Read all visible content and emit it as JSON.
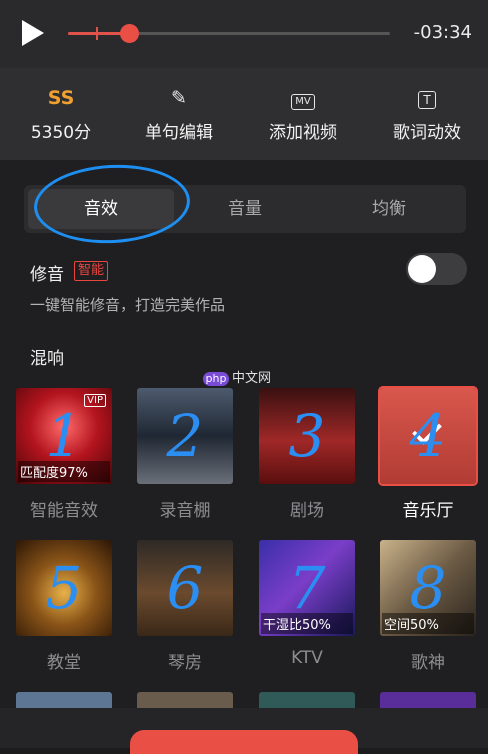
{
  "player": {
    "time_remaining": "-03:34",
    "progress": 0.19
  },
  "toolbar": [
    {
      "icon": "score-icon",
      "glyph": "SS",
      "label": "5350分"
    },
    {
      "icon": "edit-line-icon",
      "glyph": "✎",
      "label": "单句编辑"
    },
    {
      "icon": "mv-icon",
      "glyph": "MV",
      "label": "添加视频"
    },
    {
      "icon": "lyric-effect-icon",
      "glyph": "T",
      "label": "歌词动效"
    }
  ],
  "tabs": [
    "音效",
    "音量",
    "均衡"
  ],
  "tune": {
    "title": "修音",
    "badge": "智能",
    "desc": "一键智能修音，打造完美作品",
    "enabled": false
  },
  "reverb": {
    "title": "混响",
    "items": [
      {
        "name": "智能音效",
        "tag": "匹配度97%",
        "vip": "VIP",
        "digit": "1"
      },
      {
        "name": "录音棚",
        "digit": "2"
      },
      {
        "name": "剧场",
        "digit": "3"
      },
      {
        "name": "音乐厅",
        "digit": "4",
        "selected": true
      },
      {
        "name": "教堂",
        "digit": "5"
      },
      {
        "name": "琴房",
        "digit": "6"
      },
      {
        "name": "KTV",
        "tag": "干湿比50%",
        "digit": "7"
      },
      {
        "name": "歌神",
        "tag": "空间50%",
        "digit": "8"
      }
    ]
  },
  "watermark": {
    "logo": "php",
    "text": "中文网"
  },
  "colors": {
    "accent": "#e94f45",
    "annotation": "#1e8ff0"
  }
}
